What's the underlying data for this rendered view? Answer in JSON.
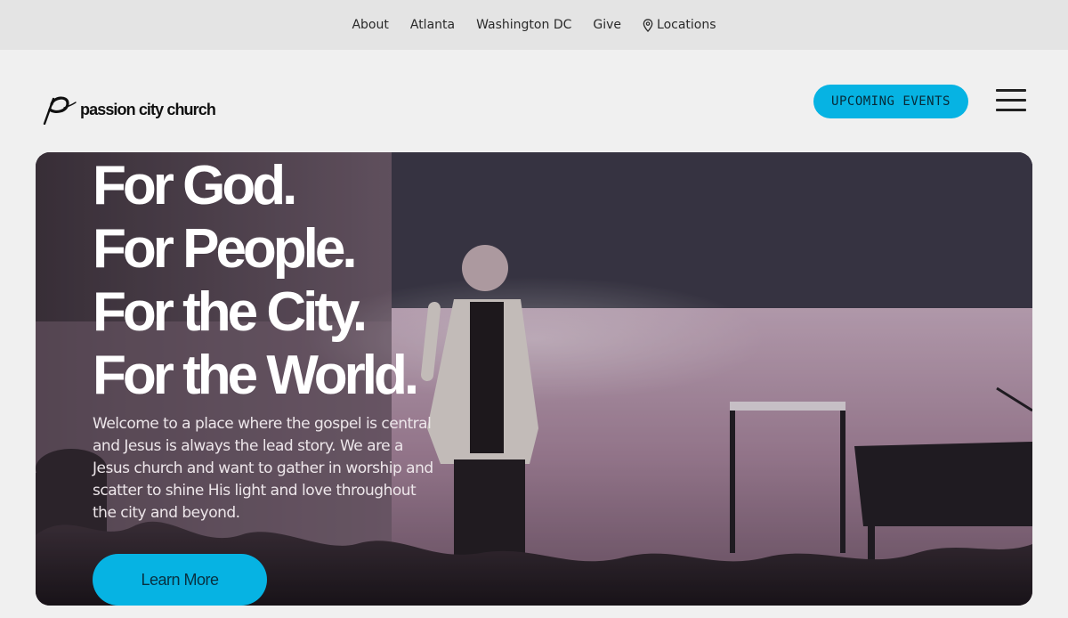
{
  "topnav": {
    "items": [
      {
        "label": "About"
      },
      {
        "label": "Atlanta"
      },
      {
        "label": "Washington DC"
      },
      {
        "label": "Give"
      },
      {
        "label": "Locations",
        "icon": "map-pin-icon"
      }
    ]
  },
  "header": {
    "logo_text": "passion city church",
    "events_label": "UPCOMING EVENTS",
    "menu_icon": "hamburger-menu-icon"
  },
  "hero": {
    "headline": [
      "For God.",
      "For People.",
      "For the City.",
      "For the World."
    ],
    "body": "Welcome to a place where the gospel is central and Jesus is always the lead story. We are a Jesus church and want to gather in worship and scatter to shine His light and love throughout the city and beyond.",
    "cta_label": "Learn More"
  },
  "colors": {
    "accent": "#06b3e3",
    "page_bg": "#f0f0f0",
    "topbar_bg": "#e4e4e4"
  }
}
